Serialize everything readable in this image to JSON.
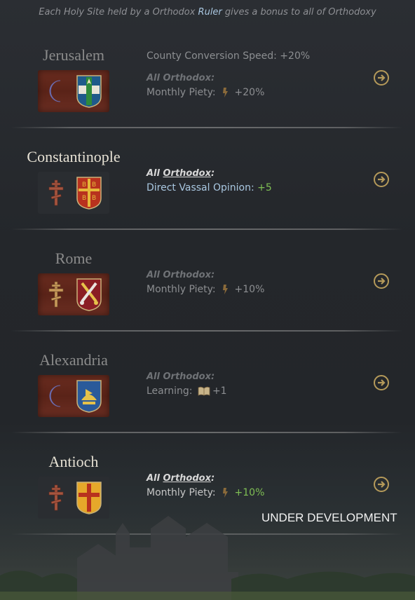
{
  "header": {
    "pre": "Each Holy Site held by a Orthodox ",
    "highlight": "Ruler",
    "post": " gives a bonus to all of Orthodoxy"
  },
  "sites": [
    {
      "name": "Jerusalem",
      "active": false,
      "faith_icon": "crescent-icon",
      "coa_icon": "jerusalem-coat-of-arms-icon",
      "extra_line": "County Conversion Speed: +20%",
      "all_label_pre": "All ",
      "all_label_faith": "Orthodox",
      "all_label_post": ":",
      "effect_label": "Monthly Piety:",
      "effect_icon": "piety-icon",
      "effect_value": "+20%",
      "effect_value_color": "grey"
    },
    {
      "name": "Constantinople",
      "active": true,
      "faith_icon": "orthodox-cross-icon",
      "coa_icon": "byzantine-coat-of-arms-icon",
      "extra_line": "",
      "all_label_pre": "All ",
      "all_label_faith": "Orthodox",
      "all_label_post": ":",
      "effect_label": "Direct Vassal Opinion:",
      "effect_icon": "",
      "effect_value": "+5",
      "effect_value_color": "green"
    },
    {
      "name": "Rome",
      "active": false,
      "faith_icon": "orthodox-cross-icon",
      "coa_icon": "papal-coat-of-arms-icon",
      "extra_line": "",
      "all_label_pre": "All ",
      "all_label_faith": "Orthodox",
      "all_label_post": ":",
      "effect_label": "Monthly Piety:",
      "effect_icon": "piety-icon",
      "effect_value": "+10%",
      "effect_value_color": "grey"
    },
    {
      "name": "Alexandria",
      "active": false,
      "faith_icon": "crescent-icon",
      "coa_icon": "alexandria-coat-of-arms-icon",
      "extra_line": "",
      "all_label_pre": "All ",
      "all_label_faith": "Orthodox",
      "all_label_post": ":",
      "effect_label": "Learning:",
      "effect_icon": "book-icon",
      "effect_value": "+1",
      "effect_value_color": "grey"
    },
    {
      "name": "Antioch",
      "active": true,
      "faith_icon": "orthodox-cross-icon",
      "coa_icon": "antioch-coat-of-arms-icon",
      "extra_line": "",
      "all_label_pre": "All ",
      "all_label_faith": "Orthodox",
      "all_label_post": ":",
      "effect_label": "Monthly Piety:",
      "effect_icon": "piety-icon",
      "effect_value": "+10%",
      "effect_value_color": "green"
    }
  ],
  "watermark": "UNDER DEVELOPMENT",
  "colors": {
    "accent_blue": "#a9c7e0",
    "positive_green": "#7fbf54",
    "goto_gold": "#b59a5a"
  }
}
